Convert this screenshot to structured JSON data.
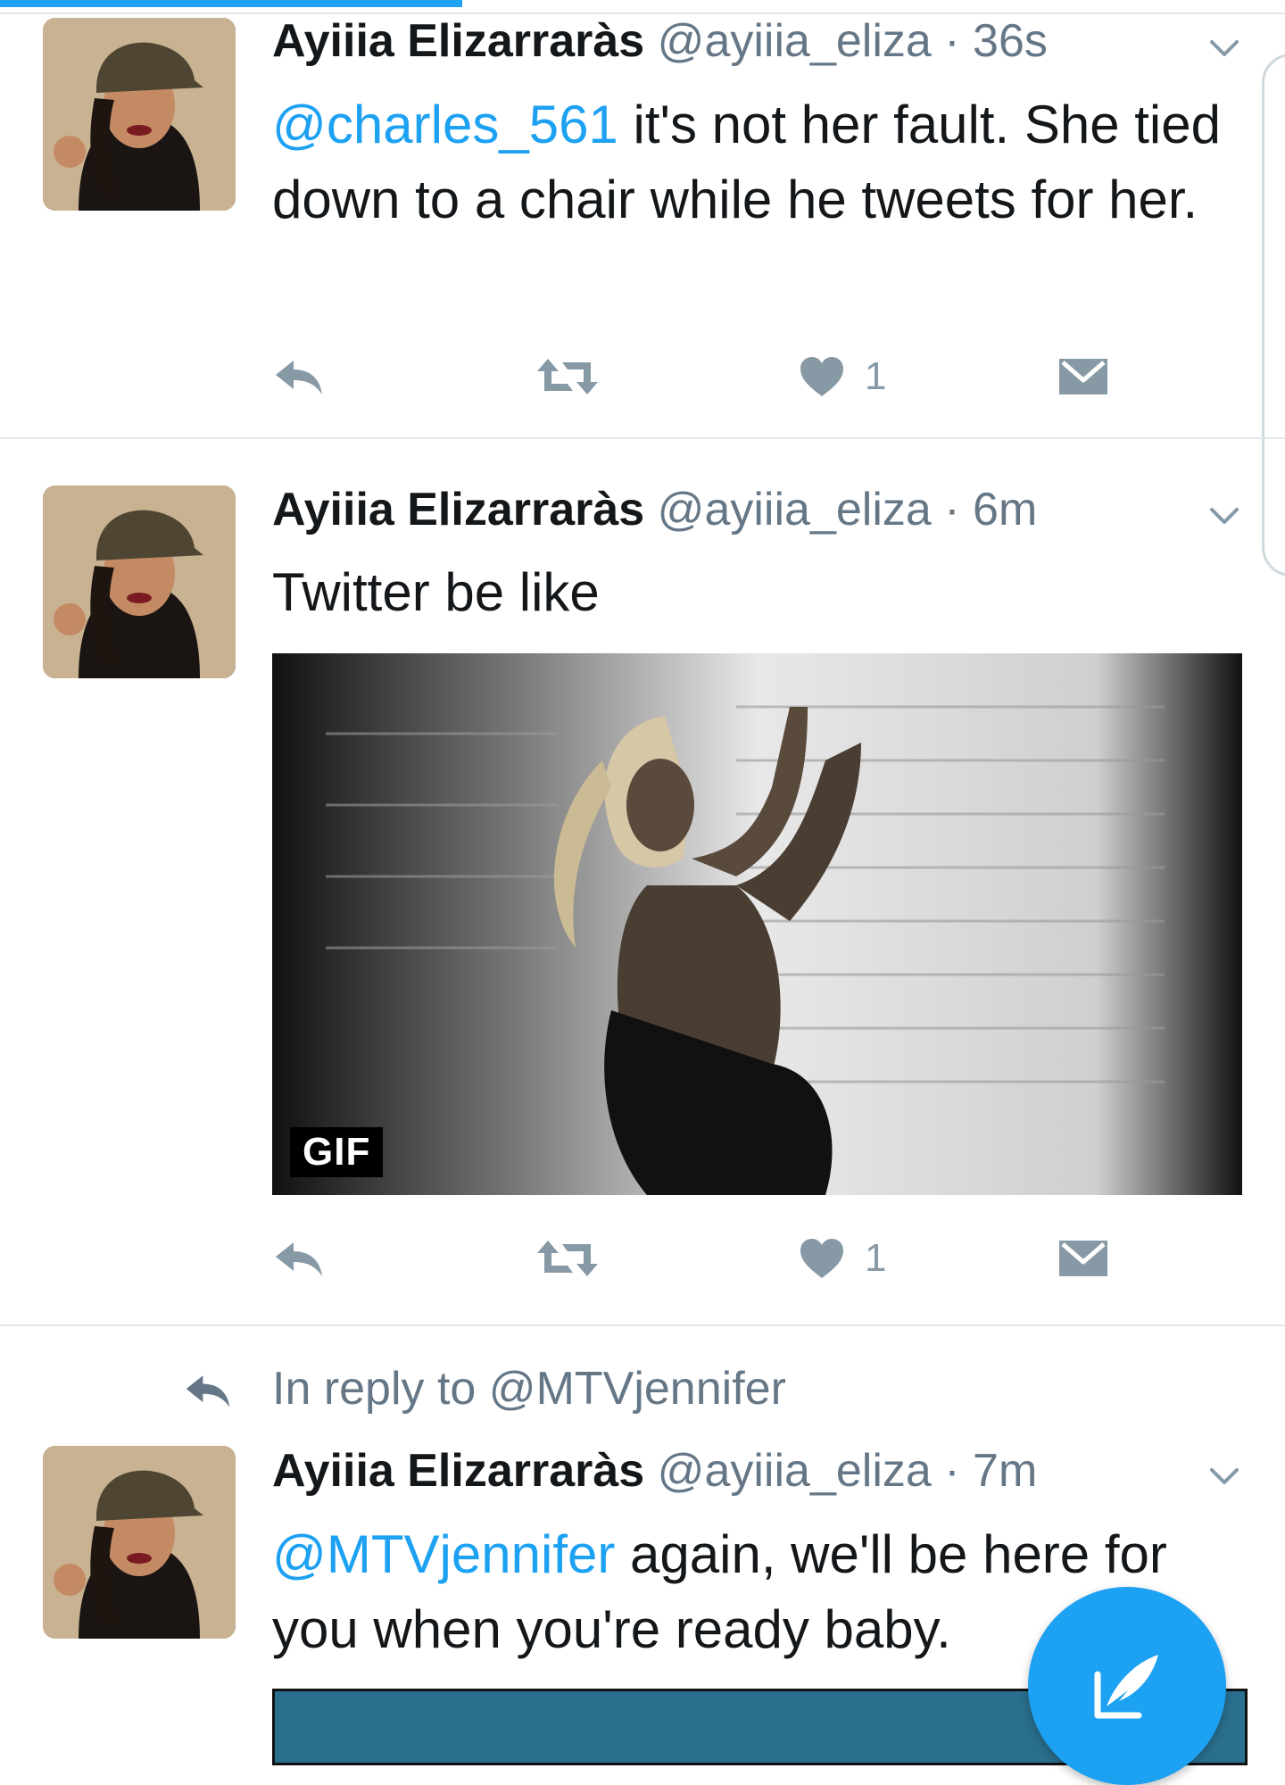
{
  "theme": {
    "accent": "#1da1f2",
    "icon_gray": "#8899a6",
    "meta_gray": "#657786"
  },
  "tweets": [
    {
      "author": "Ayiiia Elizarraràs",
      "handle": "@ayiiia_eliza",
      "time": "· 36s",
      "mention": "@charles_561",
      "text": " it's not her fault. She tied down to a chair while he tweets for her.",
      "likes": "1"
    },
    {
      "author": "Ayiiia Elizarraràs",
      "handle": "@ayiiia_eliza",
      "time": "· 6m",
      "text": "Twitter be like",
      "media_badge": "GIF",
      "likes": "1"
    },
    {
      "reply_context": "In reply to @MTVjennifer",
      "author": "Ayiiia Elizarraràs",
      "handle": "@ayiiia_eliza",
      "time": "· 7m",
      "mention": "@MTVjennifer",
      "text": " again, we'll be here for you when you're ready baby."
    }
  ],
  "icons": {
    "reply": "reply-icon",
    "retweet": "retweet-icon",
    "like": "heart-icon",
    "dm": "envelope-icon",
    "more": "chevron-down-icon",
    "compose": "compose-tweet-icon"
  }
}
